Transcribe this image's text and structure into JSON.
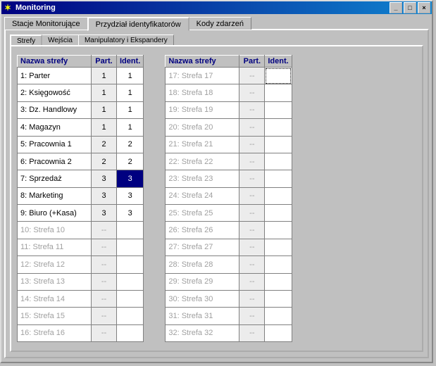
{
  "window": {
    "title": "Monitoring",
    "minimize": "_",
    "maximize": "□",
    "close": "×"
  },
  "outer_tabs": [
    {
      "label": "Stacje Monitorujące",
      "active": false
    },
    {
      "label": "Przydział identyfikatorów",
      "active": true
    },
    {
      "label": "Kody zdarzeń",
      "active": false
    }
  ],
  "inner_tabs": [
    {
      "label": "Strefy",
      "active": true
    },
    {
      "label": "Wejścia",
      "active": false
    },
    {
      "label": "Manipulatory i Ekspandery",
      "active": false
    }
  ],
  "columns": {
    "name": "Nazwa strefy",
    "part": "Part.",
    "ident": "Ident."
  },
  "left_rows": [
    {
      "name": "1: Parter",
      "part": "1",
      "ident": "1",
      "enabled": true,
      "selected": false
    },
    {
      "name": "2: Księgowość",
      "part": "1",
      "ident": "1",
      "enabled": true,
      "selected": false
    },
    {
      "name": "3: Dz. Handlowy",
      "part": "1",
      "ident": "1",
      "enabled": true,
      "selected": false
    },
    {
      "name": "4: Magazyn",
      "part": "1",
      "ident": "1",
      "enabled": true,
      "selected": false
    },
    {
      "name": "5: Pracownia 1",
      "part": "2",
      "ident": "2",
      "enabled": true,
      "selected": false
    },
    {
      "name": "6: Pracownia 2",
      "part": "2",
      "ident": "2",
      "enabled": true,
      "selected": false
    },
    {
      "name": "7: Sprzedaż",
      "part": "3",
      "ident": "3",
      "enabled": true,
      "selected": true
    },
    {
      "name": "8: Marketing",
      "part": "3",
      "ident": "3",
      "enabled": true,
      "selected": false
    },
    {
      "name": "9: Biuro (+Kasa)",
      "part": "3",
      "ident": "3",
      "enabled": true,
      "selected": false
    },
    {
      "name": "10: Strefa 10",
      "part": "--",
      "ident": "",
      "enabled": false,
      "selected": false
    },
    {
      "name": "11: Strefa 11",
      "part": "--",
      "ident": "",
      "enabled": false,
      "selected": false
    },
    {
      "name": "12: Strefa 12",
      "part": "--",
      "ident": "",
      "enabled": false,
      "selected": false
    },
    {
      "name": "13: Strefa 13",
      "part": "--",
      "ident": "",
      "enabled": false,
      "selected": false
    },
    {
      "name": "14: Strefa 14",
      "part": "--",
      "ident": "",
      "enabled": false,
      "selected": false
    },
    {
      "name": "15: Strefa 15",
      "part": "--",
      "ident": "",
      "enabled": false,
      "selected": false
    },
    {
      "name": "16: Strefa 16",
      "part": "--",
      "ident": "",
      "enabled": false,
      "selected": false
    }
  ],
  "right_rows": [
    {
      "name": "17: Strefa 17",
      "part": "--",
      "ident": "",
      "enabled": false,
      "focus": true
    },
    {
      "name": "18: Strefa 18",
      "part": "--",
      "ident": "",
      "enabled": false
    },
    {
      "name": "19: Strefa 19",
      "part": "--",
      "ident": "",
      "enabled": false
    },
    {
      "name": "20: Strefa 20",
      "part": "--",
      "ident": "",
      "enabled": false
    },
    {
      "name": "21: Strefa 21",
      "part": "--",
      "ident": "",
      "enabled": false
    },
    {
      "name": "22: Strefa 22",
      "part": "--",
      "ident": "",
      "enabled": false
    },
    {
      "name": "23: Strefa 23",
      "part": "--",
      "ident": "",
      "enabled": false
    },
    {
      "name": "24: Strefa 24",
      "part": "--",
      "ident": "",
      "enabled": false
    },
    {
      "name": "25: Strefa 25",
      "part": "--",
      "ident": "",
      "enabled": false
    },
    {
      "name": "26: Strefa 26",
      "part": "--",
      "ident": "",
      "enabled": false
    },
    {
      "name": "27: Strefa 27",
      "part": "--",
      "ident": "",
      "enabled": false
    },
    {
      "name": "28: Strefa 28",
      "part": "--",
      "ident": "",
      "enabled": false
    },
    {
      "name": "29: Strefa 29",
      "part": "--",
      "ident": "",
      "enabled": false
    },
    {
      "name": "30: Strefa 30",
      "part": "--",
      "ident": "",
      "enabled": false
    },
    {
      "name": "31: Strefa 31",
      "part": "--",
      "ident": "",
      "enabled": false
    },
    {
      "name": "32: Strefa 32",
      "part": "--",
      "ident": "",
      "enabled": false
    }
  ]
}
